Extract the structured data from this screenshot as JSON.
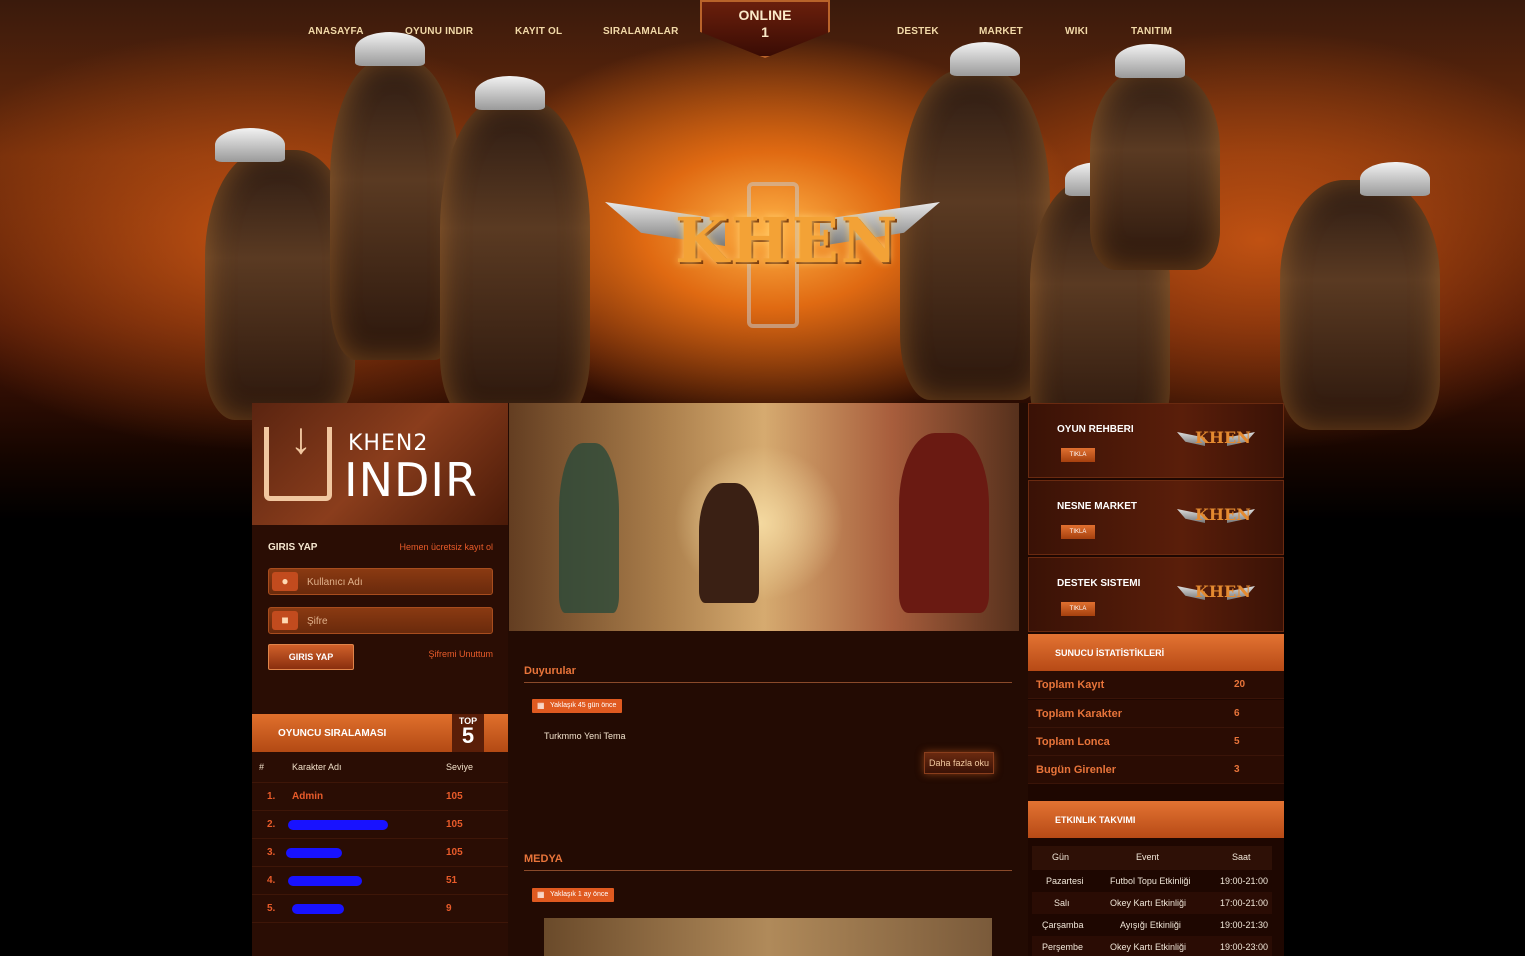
{
  "nav": {
    "items": [
      "ANASAYFA",
      "OYUNU INDIR",
      "KAYIT OL",
      "SIRALAMALAR",
      "DESTEK",
      "MARKET",
      "WIKI",
      "TANITIM"
    ],
    "online_label": "ONLINE",
    "online_count": "1"
  },
  "logo": {
    "text": "KHEN"
  },
  "download": {
    "line1": "KHEN2",
    "line2": "INDIR"
  },
  "login": {
    "title": "GIRIS YAP",
    "register_link": "Hemen ücretsiz kayıt ol",
    "username_placeholder": "Kullanıcı Adı",
    "password_placeholder": "Şifre",
    "submit_label": "GIRIS YAP",
    "forgot_link": "Şifremi Unuttum"
  },
  "ranking": {
    "title": "OYUNCU SIRALAMASI",
    "top_label": "TOP",
    "top_number": "5",
    "headers": [
      "#",
      "Karakter Adı",
      "Seviye"
    ],
    "rows": [
      {
        "num": "1.",
        "name": "Admin",
        "level": "105"
      },
      {
        "num": "2.",
        "name": "",
        "level": "105"
      },
      {
        "num": "3.",
        "name": "",
        "level": "105"
      },
      {
        "num": "4.",
        "name": "",
        "level": "51"
      },
      {
        "num": "5.",
        "name": "",
        "level": "9"
      }
    ]
  },
  "news": {
    "title": "Duyurular",
    "badge": "Yaklaşık 45 gün önce",
    "item": "Turkmmo Yeni Tema",
    "more_label": "Daha fazla oku"
  },
  "media": {
    "title": "MEDYA",
    "badge": "Yaklaşık 1 ay önce"
  },
  "quick_cards": [
    {
      "title": "OYUN REHBERI",
      "button": "TIKLA"
    },
    {
      "title": "NESNE MARKET",
      "button": "TIKLA"
    },
    {
      "title": "DESTEK SISTEMI",
      "button": "TIKLA"
    }
  ],
  "stats": {
    "title": "SUNUCU İSTATİSTİKLERİ",
    "rows": [
      {
        "label": "Toplam Kayıt",
        "value": "20"
      },
      {
        "label": "Toplam Karakter",
        "value": "6"
      },
      {
        "label": "Toplam Lonca",
        "value": "5"
      },
      {
        "label": "Bugün Girenler",
        "value": "3"
      }
    ]
  },
  "events": {
    "title": "ETKINLIK TAKVIMI",
    "headers": [
      "Gün",
      "Event",
      "Saat"
    ],
    "rows": [
      {
        "day": "Pazartesi",
        "event": "Futbol Topu Etkinliği",
        "time": "19:00-21:00"
      },
      {
        "day": "Salı",
        "event": "Okey Kartı Etkinliği",
        "time": "17:00-21:00"
      },
      {
        "day": "Çarşamba",
        "event": "Ayışığı Etkinliği",
        "time": "19:00-21:30"
      },
      {
        "day": "Perşembe",
        "event": "Okey Kartı Etkinliği",
        "time": "19:00-23:00"
      }
    ]
  },
  "colors": {
    "accent": "#e05a20",
    "link": "#e85b2a",
    "panel": "#2a0d04"
  }
}
